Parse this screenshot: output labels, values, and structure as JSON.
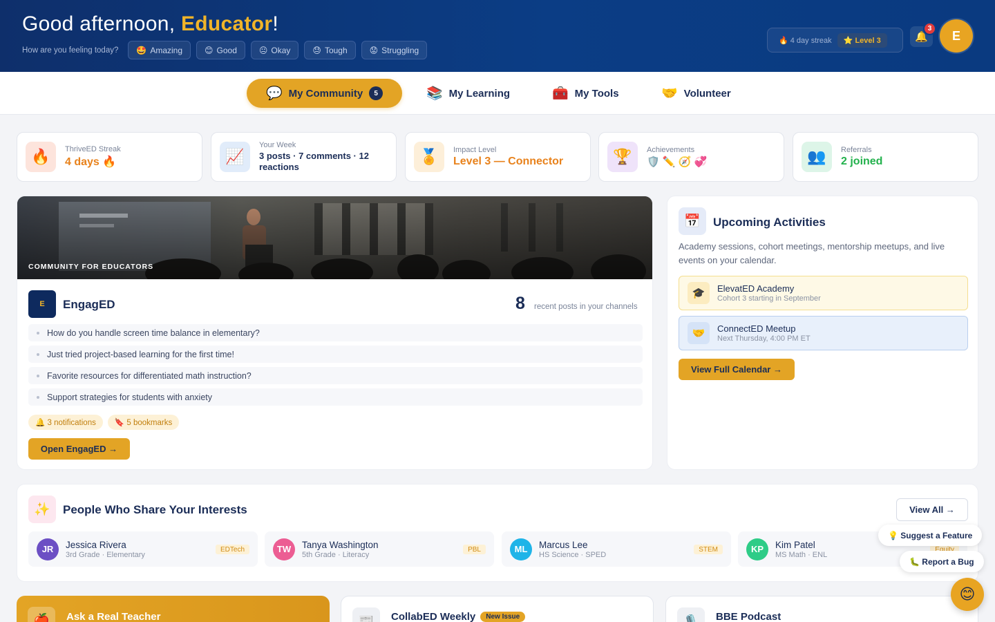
{
  "header": {
    "greeting_prefix": "Good afternoon, ",
    "greeting_name": "Educator",
    "greeting_suffix": "!",
    "feeling_prompt": "How are you feeling today?",
    "moods": [
      {
        "emoji": "🤩",
        "label": "Amazing"
      },
      {
        "emoji": "😊",
        "label": "Good"
      },
      {
        "emoji": "😐",
        "label": "Okay"
      },
      {
        "emoji": "😓",
        "label": "Tough"
      },
      {
        "emoji": "😟",
        "label": "Struggling"
      }
    ],
    "streak_text": "🔥 4 day streak",
    "level_text": "⭐ Level 3",
    "notification_count": "3",
    "avatar_initial": "E"
  },
  "nav": {
    "tabs": [
      {
        "emoji": "💬",
        "label": "My Community",
        "badge": "5",
        "active": true
      },
      {
        "emoji": "📚",
        "label": "My Learning"
      },
      {
        "emoji": "🧰",
        "label": "My Tools"
      },
      {
        "emoji": "🤝",
        "label": "Volunteer"
      }
    ]
  },
  "stats": [
    {
      "icon": "🔥",
      "label": "ThriveED Streak",
      "value": "4 days 🔥",
      "color": "#e8821c",
      "bg": "#fde4dc"
    },
    {
      "icon": "📈",
      "label": "Your Week",
      "value": "3 posts · 7 comments · 12 reactions",
      "color": "#1b2d57",
      "bg": "#e1ecfa"
    },
    {
      "icon": "🏅",
      "label": "Impact Level",
      "value": "Level 3 — Connector",
      "color": "#e8821c",
      "bg": "#fdefd9"
    },
    {
      "icon": "🏆",
      "label": "Achievements",
      "value": "🛡️ ✏️ 🧭 💞",
      "color": "#1b2d57",
      "bg": "#efe3fa"
    },
    {
      "icon": "👥",
      "label": "Referrals",
      "value": "2 joined",
      "color": "#22b14c",
      "bg": "#ddf5e8"
    }
  ],
  "community": {
    "photo_tag": "COMMUNITY FOR EDUCATORS",
    "logo_text": "E",
    "title": "EngagED",
    "post_count": "8",
    "post_count_label": "recent posts in your channels",
    "posts": [
      "How do you handle screen time balance in elementary?",
      "Just tried project-based learning for the first time!",
      "Favorite resources for differentiated math instruction?",
      "Support strategies for students with anxiety"
    ],
    "chips": [
      "🔔 3 notifications",
      "🔖 5 bookmarks"
    ],
    "open_button": "Open EngagED →"
  },
  "upcoming": {
    "icon": "📅",
    "title": "Upcoming Activities",
    "description": "Academy sessions, cohort meetings, mentorship meetups, and live events on your calendar.",
    "events": [
      {
        "icon": "🎓",
        "title": "ElevatED Academy",
        "subtitle": "Cohort 3 starting in September"
      },
      {
        "icon": "🤝",
        "title": "ConnectED Meetup",
        "subtitle": "Next Thursday, 4:00 PM ET"
      }
    ],
    "calendar_button": "View Full Calendar →"
  },
  "people": {
    "icon": "✨",
    "title": "People Who Share Your Interests",
    "view_all": "View All →",
    "list": [
      {
        "initials": "JR",
        "name": "Jessica Rivera",
        "role": "3rd Grade · Elementary",
        "tag": "EDTech",
        "color": "#6c4fc4"
      },
      {
        "initials": "TW",
        "name": "Tanya Washington",
        "role": "5th Grade · Literacy",
        "tag": "PBL",
        "color": "#ec5d93"
      },
      {
        "initials": "ML",
        "name": "Marcus Lee",
        "role": "HS Science · SPED",
        "tag": "STEM",
        "color": "#1fb4e8"
      },
      {
        "initials": "KP",
        "name": "Kim Patel",
        "role": "MS Math · ENL",
        "tag": "Equity",
        "color": "#2ecc87"
      }
    ]
  },
  "floating": {
    "suggest": "💡 Suggest a Feature",
    "bug": "🐛 Report a Bug",
    "smiley": "😊"
  },
  "bottom": {
    "ask": {
      "icon": "🍎",
      "title": "Ask a Real Teacher"
    },
    "collab": {
      "icon": "📰",
      "title": "CollabED Weekly",
      "badge": "New Issue"
    },
    "podcast": {
      "icon": "🎙️",
      "title": "BBE Podcast"
    }
  }
}
